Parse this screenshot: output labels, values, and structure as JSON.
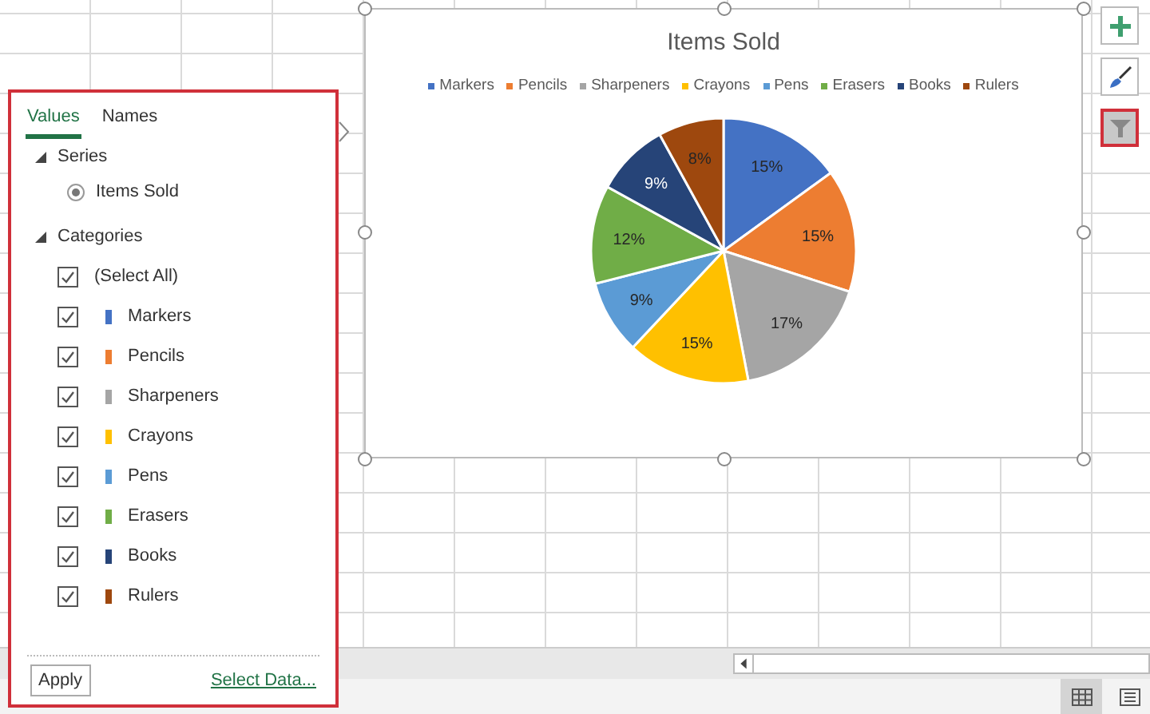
{
  "filter_panel": {
    "tabs": [
      {
        "label": "Values",
        "selected": true
      },
      {
        "label": "Names",
        "selected": false
      }
    ],
    "series_section": {
      "heading": "Series",
      "expanded": true,
      "items": [
        {
          "label": "Items Sold",
          "selected": true
        }
      ]
    },
    "categories_section": {
      "heading": "Categories",
      "expanded": true,
      "select_all": {
        "label": "(Select All)",
        "checked": true
      },
      "items": [
        {
          "label": "Markers",
          "checked": true,
          "color": "#4472c4"
        },
        {
          "label": "Pencils",
          "checked": true,
          "color": "#ed7d31"
        },
        {
          "label": "Sharpeners",
          "checked": true,
          "color": "#a5a5a5"
        },
        {
          "label": "Crayons",
          "checked": true,
          "color": "#ffc000"
        },
        {
          "label": "Pens",
          "checked": true,
          "color": "#5b9bd5"
        },
        {
          "label": "Erasers",
          "checked": true,
          "color": "#70ad47"
        },
        {
          "label": "Books",
          "checked": true,
          "color": "#264478"
        },
        {
          "label": "Rulers",
          "checked": true,
          "color": "#9e480e"
        }
      ]
    },
    "apply_button": "Apply",
    "select_data_link": "Select Data..."
  },
  "chart": {
    "chart_data": {
      "type": "pie",
      "title": "Items Sold",
      "categories": [
        "Markers",
        "Pencils",
        "Sharpeners",
        "Crayons",
        "Pens",
        "Erasers",
        "Books",
        "Rulers"
      ],
      "series": [
        {
          "values": [
            15,
            15,
            17,
            15,
            9,
            12,
            9,
            8
          ]
        }
      ],
      "value_labels": [
        "15%",
        "15%",
        "17%",
        "15%",
        "9%",
        "12%",
        "9%",
        "8%"
      ]
    }
  },
  "chart_buttons": [
    {
      "kind": "add",
      "selected": false
    },
    {
      "kind": "style",
      "selected": false
    },
    {
      "kind": "filter",
      "selected": true
    }
  ],
  "view_buttons": [
    {
      "kind": "normal",
      "selected": true
    },
    {
      "kind": "page_layout",
      "selected": false
    }
  ]
}
